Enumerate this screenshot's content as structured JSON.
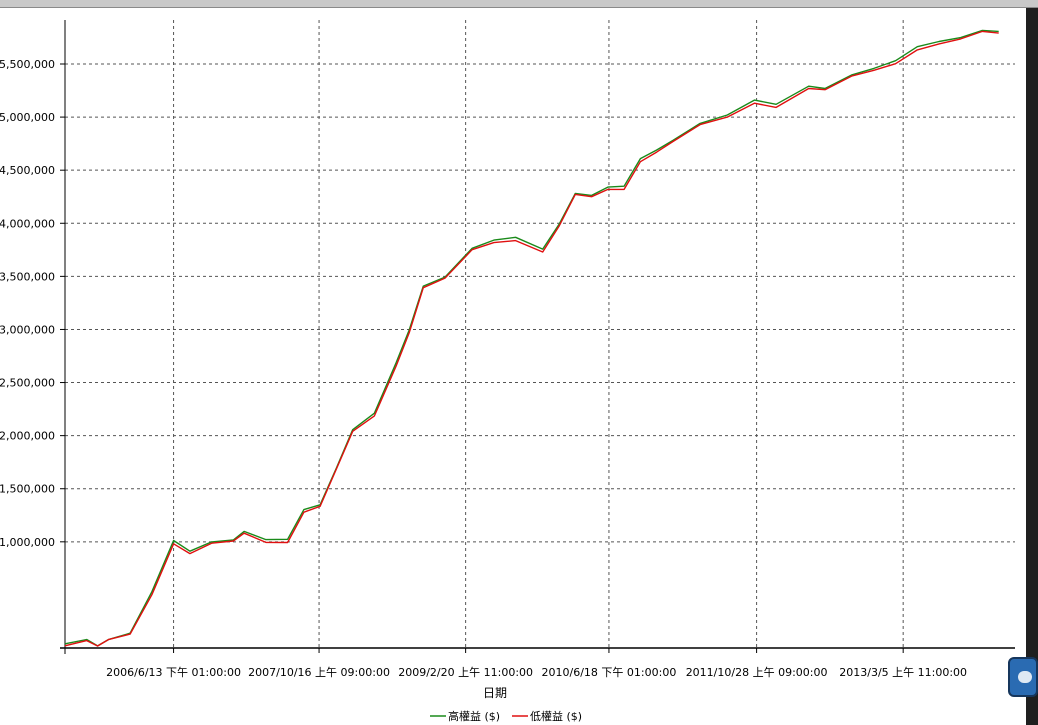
{
  "chart_data": {
    "type": "line",
    "title": "",
    "xlabel": "日期",
    "ylabel": "",
    "ylim": [
      0,
      5800000
    ],
    "x_ticks": [
      "2006/6/13 下午 01:00:00",
      "2007/10/16 上午 09:00:00",
      "2009/2/20 上午 11:00:00",
      "2010/6/18 下午 01:00:00",
      "2011/10/28 上午 09:00:00",
      "2013/3/5 上午 11:00:00"
    ],
    "y_ticks": [
      "1,000,000",
      "1,500,000",
      "2,000,000",
      "2,500,000",
      "3,000,000",
      "3,500,000",
      "4,000,000",
      "4,500,000",
      "5,000,000",
      "5,500,000"
    ],
    "y_tick_values": [
      1000000,
      1500000,
      2000000,
      2500000,
      3000000,
      3500000,
      4000000,
      4500000,
      5000000,
      5500000
    ],
    "x_tick_years": [
      2006.45,
      2007.79,
      2009.14,
      2010.46,
      2011.82,
      2013.17
    ],
    "xlim": [
      2005.45,
      2014.2
    ],
    "grid": true,
    "legend": "bottom",
    "series": [
      {
        "name": "高權益 ($)",
        "color": "#1a8a1a",
        "x": [
          2005.45,
          2005.65,
          2005.75,
          2005.85,
          2006.05,
          2006.25,
          2006.45,
          2006.6,
          2006.8,
          2007.0,
          2007.1,
          2007.3,
          2007.5,
          2007.65,
          2007.8,
          2007.95,
          2008.1,
          2008.3,
          2008.5,
          2008.62,
          2008.75,
          2008.95,
          2009.2,
          2009.4,
          2009.6,
          2009.85,
          2010.0,
          2010.15,
          2010.3,
          2010.45,
          2010.6,
          2010.75,
          2010.9,
          2011.05,
          2011.3,
          2011.55,
          2011.8,
          2012.0,
          2012.3,
          2012.45,
          2012.7,
          2012.9,
          2013.1,
          2013.3,
          2013.5,
          2013.7,
          2013.9,
          2014.05
        ],
        "y": [
          40000,
          90000,
          30000,
          80000,
          130000,
          520000,
          1010000,
          920000,
          1010000,
          1020000,
          1090000,
          1010000,
          1020000,
          1310000,
          1360000,
          1700000,
          2050000,
          2200000,
          2680000,
          3000000,
          3420000,
          3500000,
          3760000,
          3830000,
          3860000,
          3760000,
          4000000,
          4290000,
          4260000,
          4330000,
          4340000,
          4610000,
          4700000,
          4790000,
          4940000,
          5010000,
          5150000,
          5120000,
          5300000,
          5280000,
          5400000,
          5450000,
          5520000,
          5660000,
          5720000,
          5760000,
          5820000,
          5800000
        ]
      },
      {
        "name": "低權益 ($)",
        "color": "#e01010",
        "x": [
          2005.45,
          2005.65,
          2005.75,
          2005.85,
          2006.05,
          2006.25,
          2006.45,
          2006.6,
          2006.8,
          2007.0,
          2007.1,
          2007.3,
          2007.5,
          2007.65,
          2007.8,
          2007.95,
          2008.1,
          2008.3,
          2008.5,
          2008.62,
          2008.75,
          2008.95,
          2009.2,
          2009.4,
          2009.6,
          2009.85,
          2010.0,
          2010.15,
          2010.3,
          2010.45,
          2010.6,
          2010.75,
          2010.9,
          2011.05,
          2011.3,
          2011.55,
          2011.8,
          2012.0,
          2012.3,
          2012.45,
          2012.7,
          2012.9,
          2013.1,
          2013.3,
          2013.5,
          2013.7,
          2013.9,
          2014.05
        ],
        "y": [
          30000,
          80000,
          20000,
          70000,
          120000,
          500000,
          990000,
          900000,
          990000,
          1000000,
          1070000,
          990000,
          1000000,
          1290000,
          1340000,
          1680000,
          2030000,
          2180000,
          2660000,
          2980000,
          3400000,
          3480000,
          3740000,
          3810000,
          3840000,
          3740000,
          3980000,
          4270000,
          4240000,
          4310000,
          4320000,
          4590000,
          4680000,
          4770000,
          4920000,
          4990000,
          5130000,
          5100000,
          5280000,
          5260000,
          5380000,
          5430000,
          5500000,
          5640000,
          5700000,
          5740000,
          5800000,
          5780000
        ]
      }
    ]
  }
}
